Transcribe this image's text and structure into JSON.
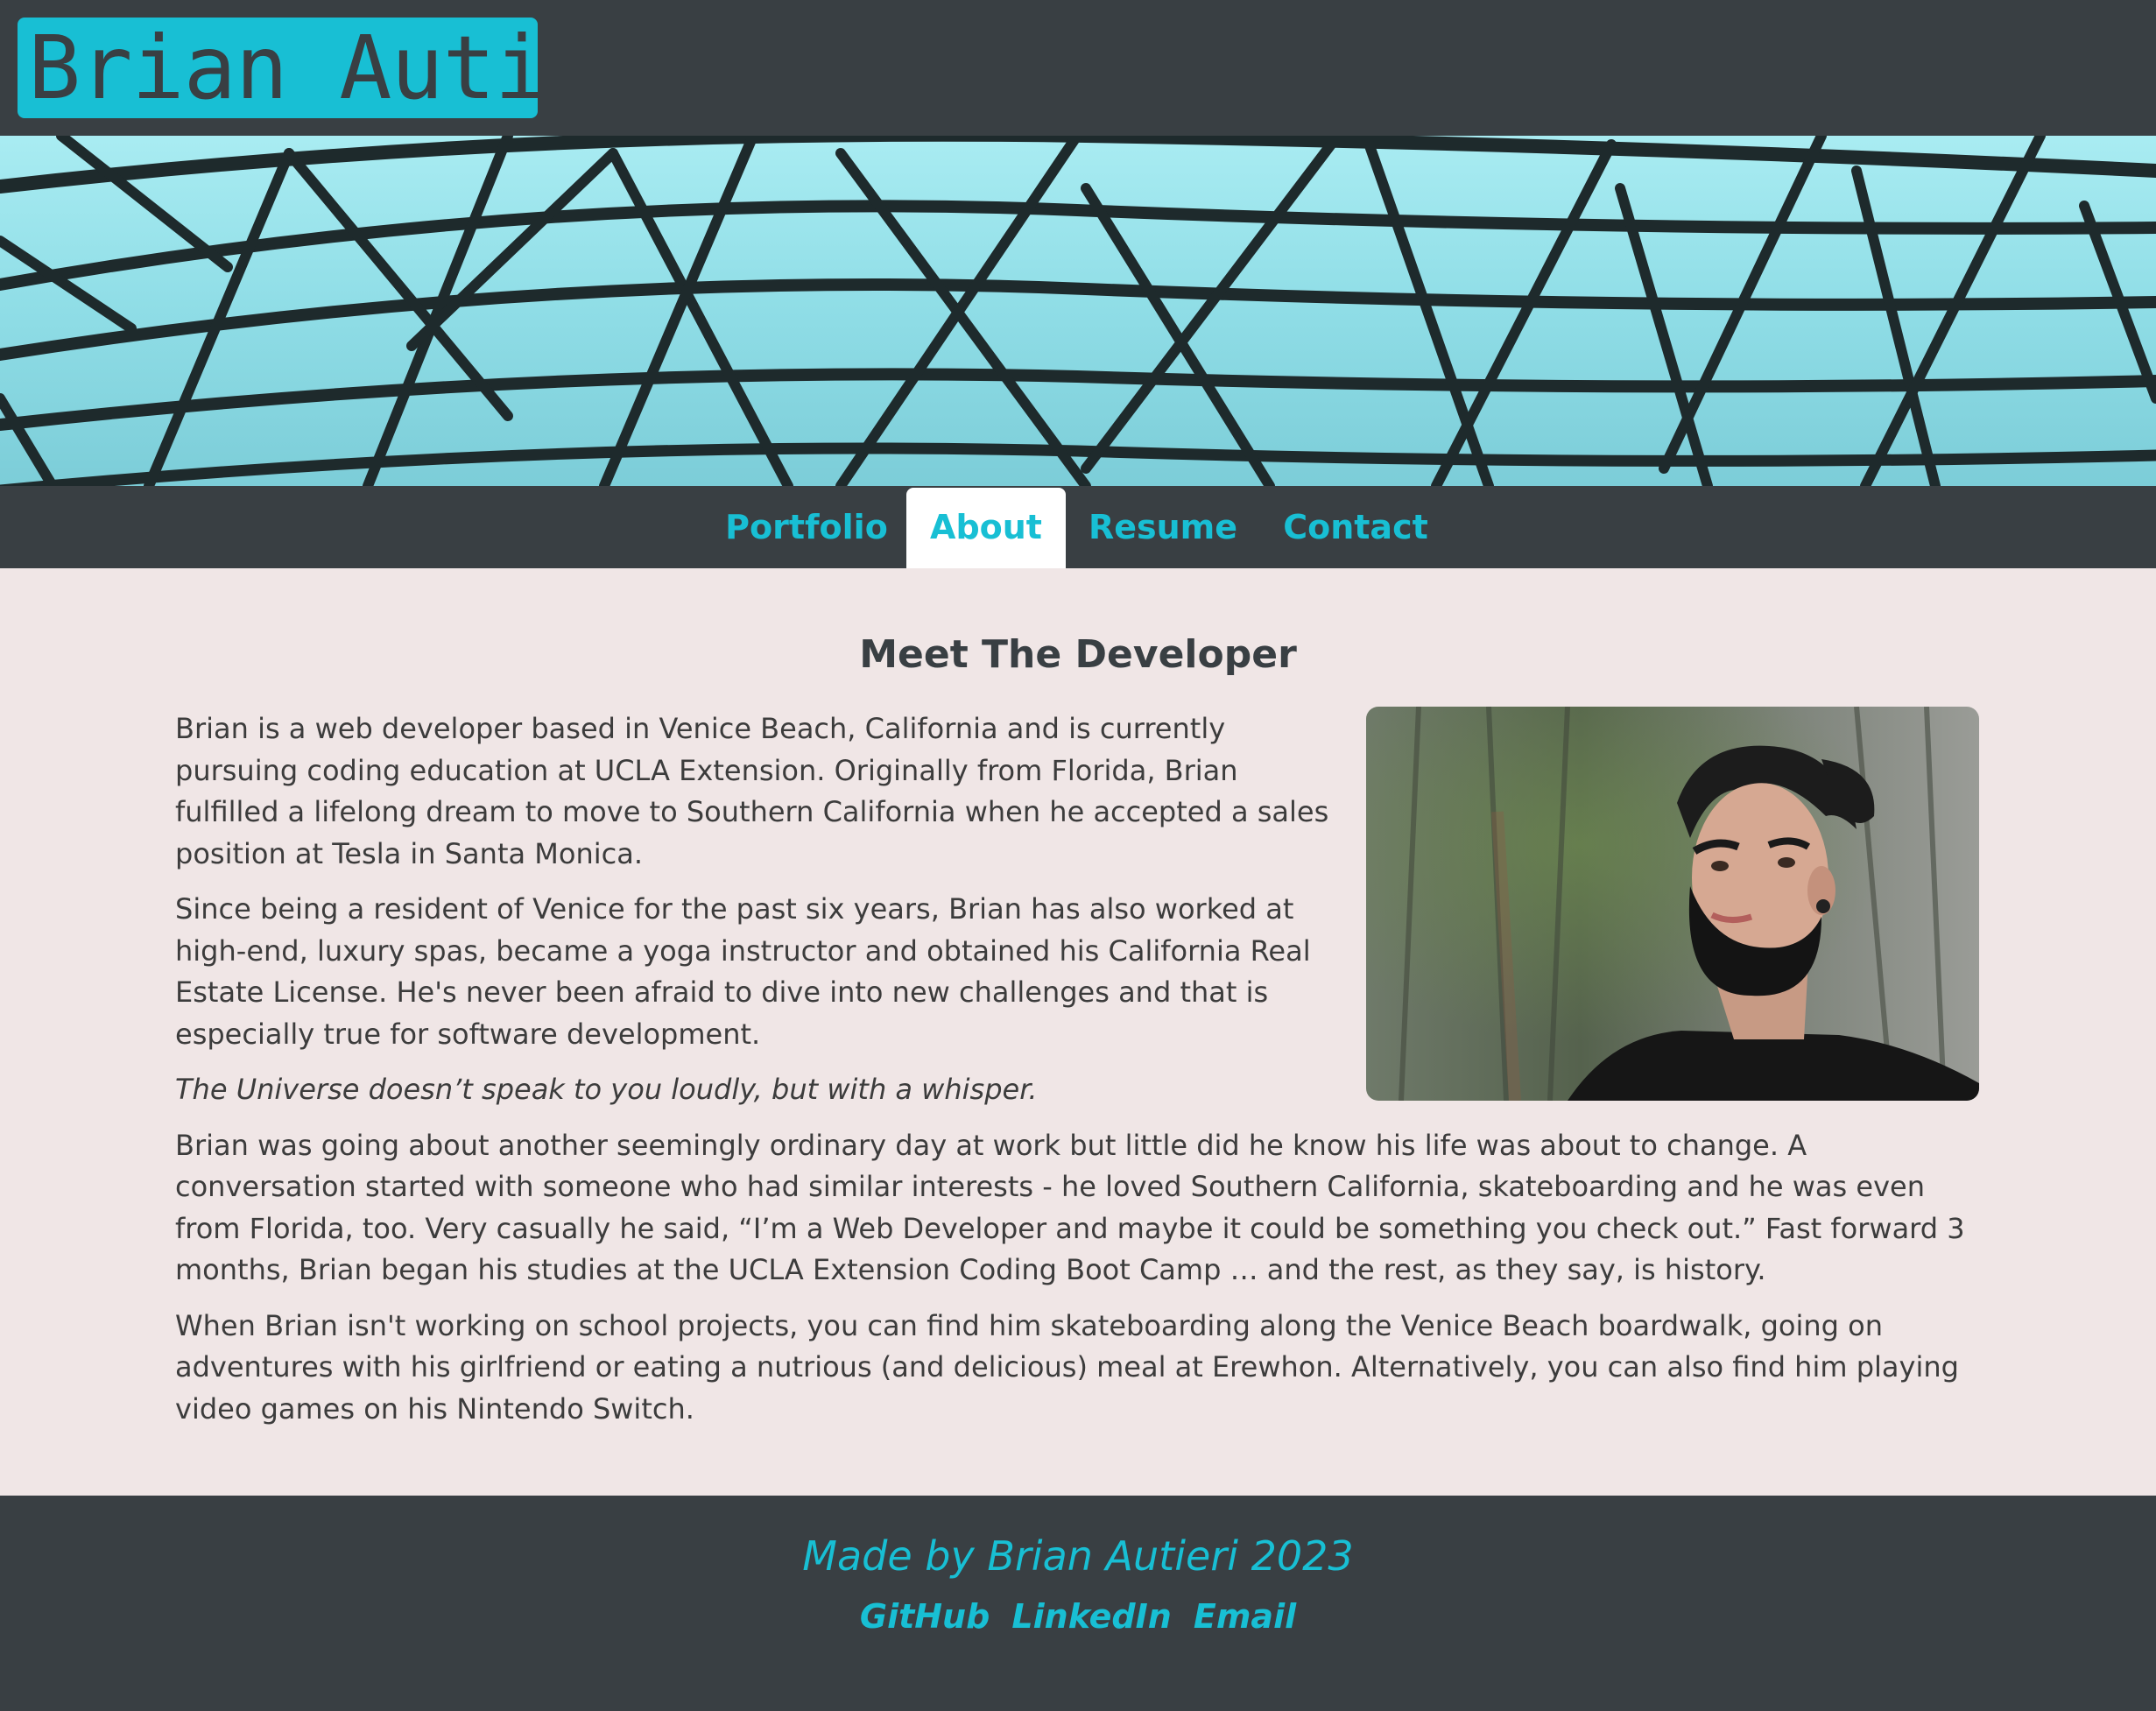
{
  "header": {
    "logo_text": "Brian Autieri"
  },
  "nav": {
    "items": [
      {
        "label": "Portfolio"
      },
      {
        "label": "About"
      },
      {
        "label": "Resume"
      },
      {
        "label": "Contact"
      }
    ]
  },
  "main": {
    "title": "Meet The Developer",
    "paragraphs": [
      "Brian is a web developer based in Venice Beach, California and is currently pursuing coding education at UCLA Extension. Originally from Florida, Brian fulfilled a lifelong dream to move to Southern California when he accepted a sales position at Tesla in Santa Monica.",
      "Since being a resident of Venice for the past six years, Brian has also worked at high-end, luxury spas, became a yoga instructor and obtained his California Real Estate License. He's never been afraid to dive into new challenges and that is especially true for software development.",
      "The Universe doesn’t speak to you loudly, but with a whisper.",
      "Brian was going about another seemingly ordinary day at work but little did he know his life was about to change. A conversation started with someone who had similar interests - he loved Southern California, skateboarding and he was even from Florida, too. Very casually he said, “I’m a Web Developer and maybe it could be something you check out.” Fast forward 3 months, Brian began his studies at the UCLA Extension Coding Boot Camp … and the rest, as they say, is history.",
      "When Brian isn't working on school projects, you can find him skateboarding along the Venice Beach boardwalk, going on adventures with his girlfriend or eating a nutrious (and delicious) meal at Erewhon. Alternatively, you can also find him playing video games on his Nintendo Switch."
    ]
  },
  "footer": {
    "credit": "Made by Brian Autieri 2023",
    "links": [
      {
        "label": "GitHub"
      },
      {
        "label": "LinkedIn"
      },
      {
        "label": "Email"
      }
    ]
  },
  "colors": {
    "accent": "#18bfd4",
    "dark": "#393f43",
    "content_bg": "#f0e6e6",
    "text": "#3c3c3c"
  }
}
